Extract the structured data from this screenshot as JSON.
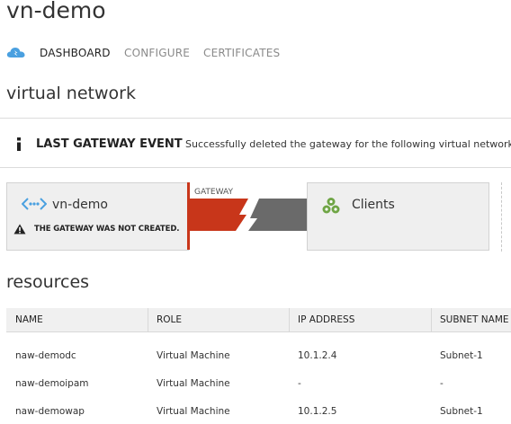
{
  "page_title": "vn-demo",
  "tabs": [
    {
      "label": "DASHBOARD",
      "active": true
    },
    {
      "label": "CONFIGURE",
      "active": false
    },
    {
      "label": "CERTIFICATES",
      "active": false
    }
  ],
  "virtual_network_heading": "virtual network",
  "gateway_event": {
    "label": "LAST GATEWAY EVENT",
    "message": "Successfully deleted the gateway for the following virtual network: vn"
  },
  "diagram": {
    "network_name": "vn-demo",
    "warning": "THE GATEWAY WAS NOT CREATED.",
    "gateway_label": "GATEWAY",
    "clients_label": "Clients"
  },
  "resources": {
    "heading": "resources",
    "columns": [
      "NAME",
      "ROLE",
      "IP ADDRESS",
      "SUBNET NAME"
    ],
    "rows": [
      [
        "naw-demodc",
        "Virtual Machine",
        "10.1.2.4",
        "Subnet-1"
      ],
      [
        "naw-demoipam",
        "Virtual Machine",
        "-",
        "-"
      ],
      [
        "naw-demowap",
        "Virtual Machine",
        "10.1.2.5",
        "Subnet-1"
      ]
    ]
  },
  "colors": {
    "accent_blue": "#4aa0e0",
    "gateway_red": "#c8361a",
    "connector_gray": "#6a6a6a",
    "clients_green": "#6fa545"
  },
  "icons": [
    "virtual-network-icon",
    "info-icon",
    "vnet-link-icon",
    "warning-icon",
    "clients-icon"
  ]
}
